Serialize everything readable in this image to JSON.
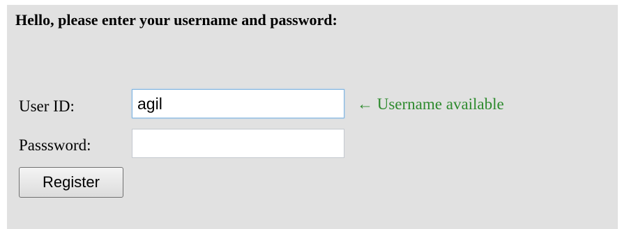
{
  "form": {
    "greeting": "Hello, please enter your username and password:",
    "user_id": {
      "label": "User ID:",
      "value": "agil"
    },
    "password": {
      "label": "Passsword:",
      "value": ""
    },
    "availability": {
      "text": "← Username available",
      "color": "#2d8a2d"
    },
    "register_label": "Register"
  }
}
